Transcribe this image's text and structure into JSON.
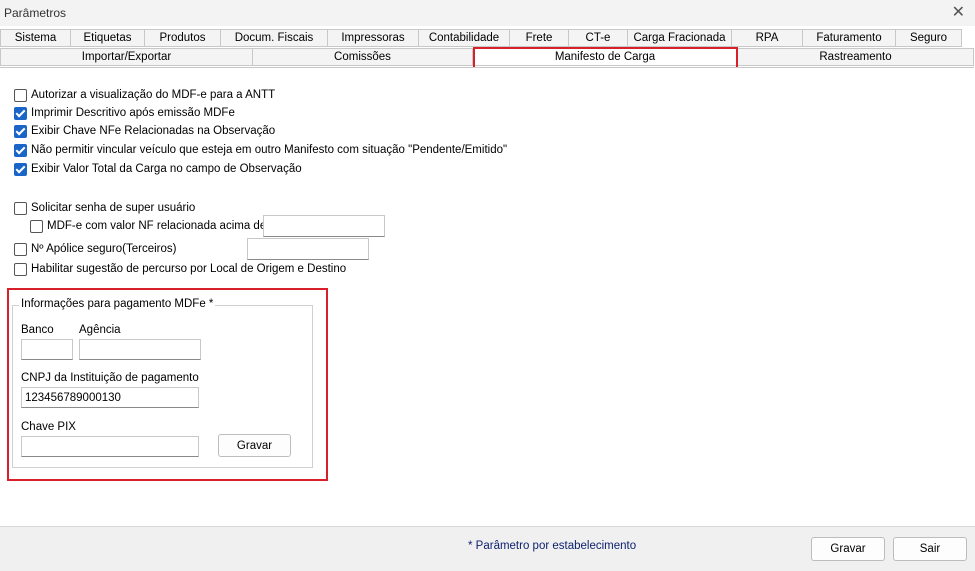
{
  "window": {
    "title": "Parâmetros",
    "close_glyph": "✕"
  },
  "tabs_row1": [
    "Sistema",
    "Etiquetas",
    "Produtos",
    "Docum. Fiscais",
    "Impressoras",
    "Contabilidade",
    "Frete",
    "CT-e",
    "Carga Fracionada",
    "RPA",
    "Faturamento",
    "Seguro"
  ],
  "tabs_row2": [
    "Importar/Exportar",
    "Comissões",
    "Manifesto de Carga",
    "Rastreamento"
  ],
  "active_tab": "Manifesto de Carga",
  "options": [
    {
      "label": "Autorizar a visualização do MDF-e para a ANTT",
      "checked": false
    },
    {
      "label": "Imprimir Descritivo após emissão MDFe",
      "checked": true
    },
    {
      "label": "Exibir Chave NFe Relacionadas na Observação",
      "checked": true
    },
    {
      "label": "Não permitir vincular veículo que esteja em outro Manifesto com situação \"Pendente/Emitido\"",
      "checked": true
    },
    {
      "label": "Exibir Valor Total da Carga no campo de Observação",
      "checked": true
    }
  ],
  "extra": {
    "super_user": {
      "label": "Solicitar senha de super usuário",
      "checked": false
    },
    "mdfe_valor": {
      "label": "MDF-e com valor NF relacionada acima de",
      "checked": false,
      "value": ""
    },
    "apolice": {
      "label": "Nº Apólice seguro(Terceiros)",
      "checked": false,
      "value": ""
    },
    "percurso": {
      "label": "Habilitar sugestão de percurso por Local de Origem e Destino",
      "checked": false
    }
  },
  "payment": {
    "title": "Informações para pagamento MDFe *",
    "banco_label": "Banco",
    "banco_value": "",
    "agencia_label": "Agência",
    "agencia_value": "",
    "cnpj_label": "CNPJ da Instituição de pagamento",
    "cnpj_value": "123456789000130",
    "pix_label": "Chave PIX",
    "pix_value": "",
    "save_label": "Gravar"
  },
  "footer": {
    "note": "* Parâmetro por estabelecimento",
    "save_label": "Gravar",
    "exit_label": "Sair"
  },
  "colors": {
    "check_on": "#1a66c8",
    "highlight": "#d7202a",
    "note_text": "#0b1f6b"
  }
}
